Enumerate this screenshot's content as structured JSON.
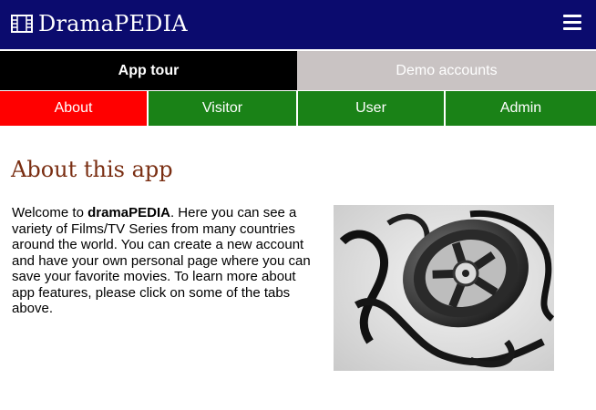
{
  "header": {
    "brand": "DramaPEDIA",
    "brand_icon": "film-icon",
    "menu_icon": "hamburger-menu-icon",
    "background_color": "#0b0b6e"
  },
  "tabs": {
    "app_tour": "App tour",
    "demo_accounts": "Demo accounts"
  },
  "subtabs": {
    "about": "About",
    "visitor": "Visitor",
    "user": "User",
    "admin": "Admin",
    "active_color": "#ff0000",
    "inactive_color": "#1a8217"
  },
  "main": {
    "title": "About this app",
    "intro_before": "Welcome to ",
    "intro_bold": "dramaPEDIA",
    "intro_after": ". Here you can see a variety of Films/TV Series from many countries around the world. You can create a new account and have your own personal page where you can save your favorite movies. To learn more about app features, please click on some of the tabs above.",
    "image": "film-reel-photo"
  }
}
